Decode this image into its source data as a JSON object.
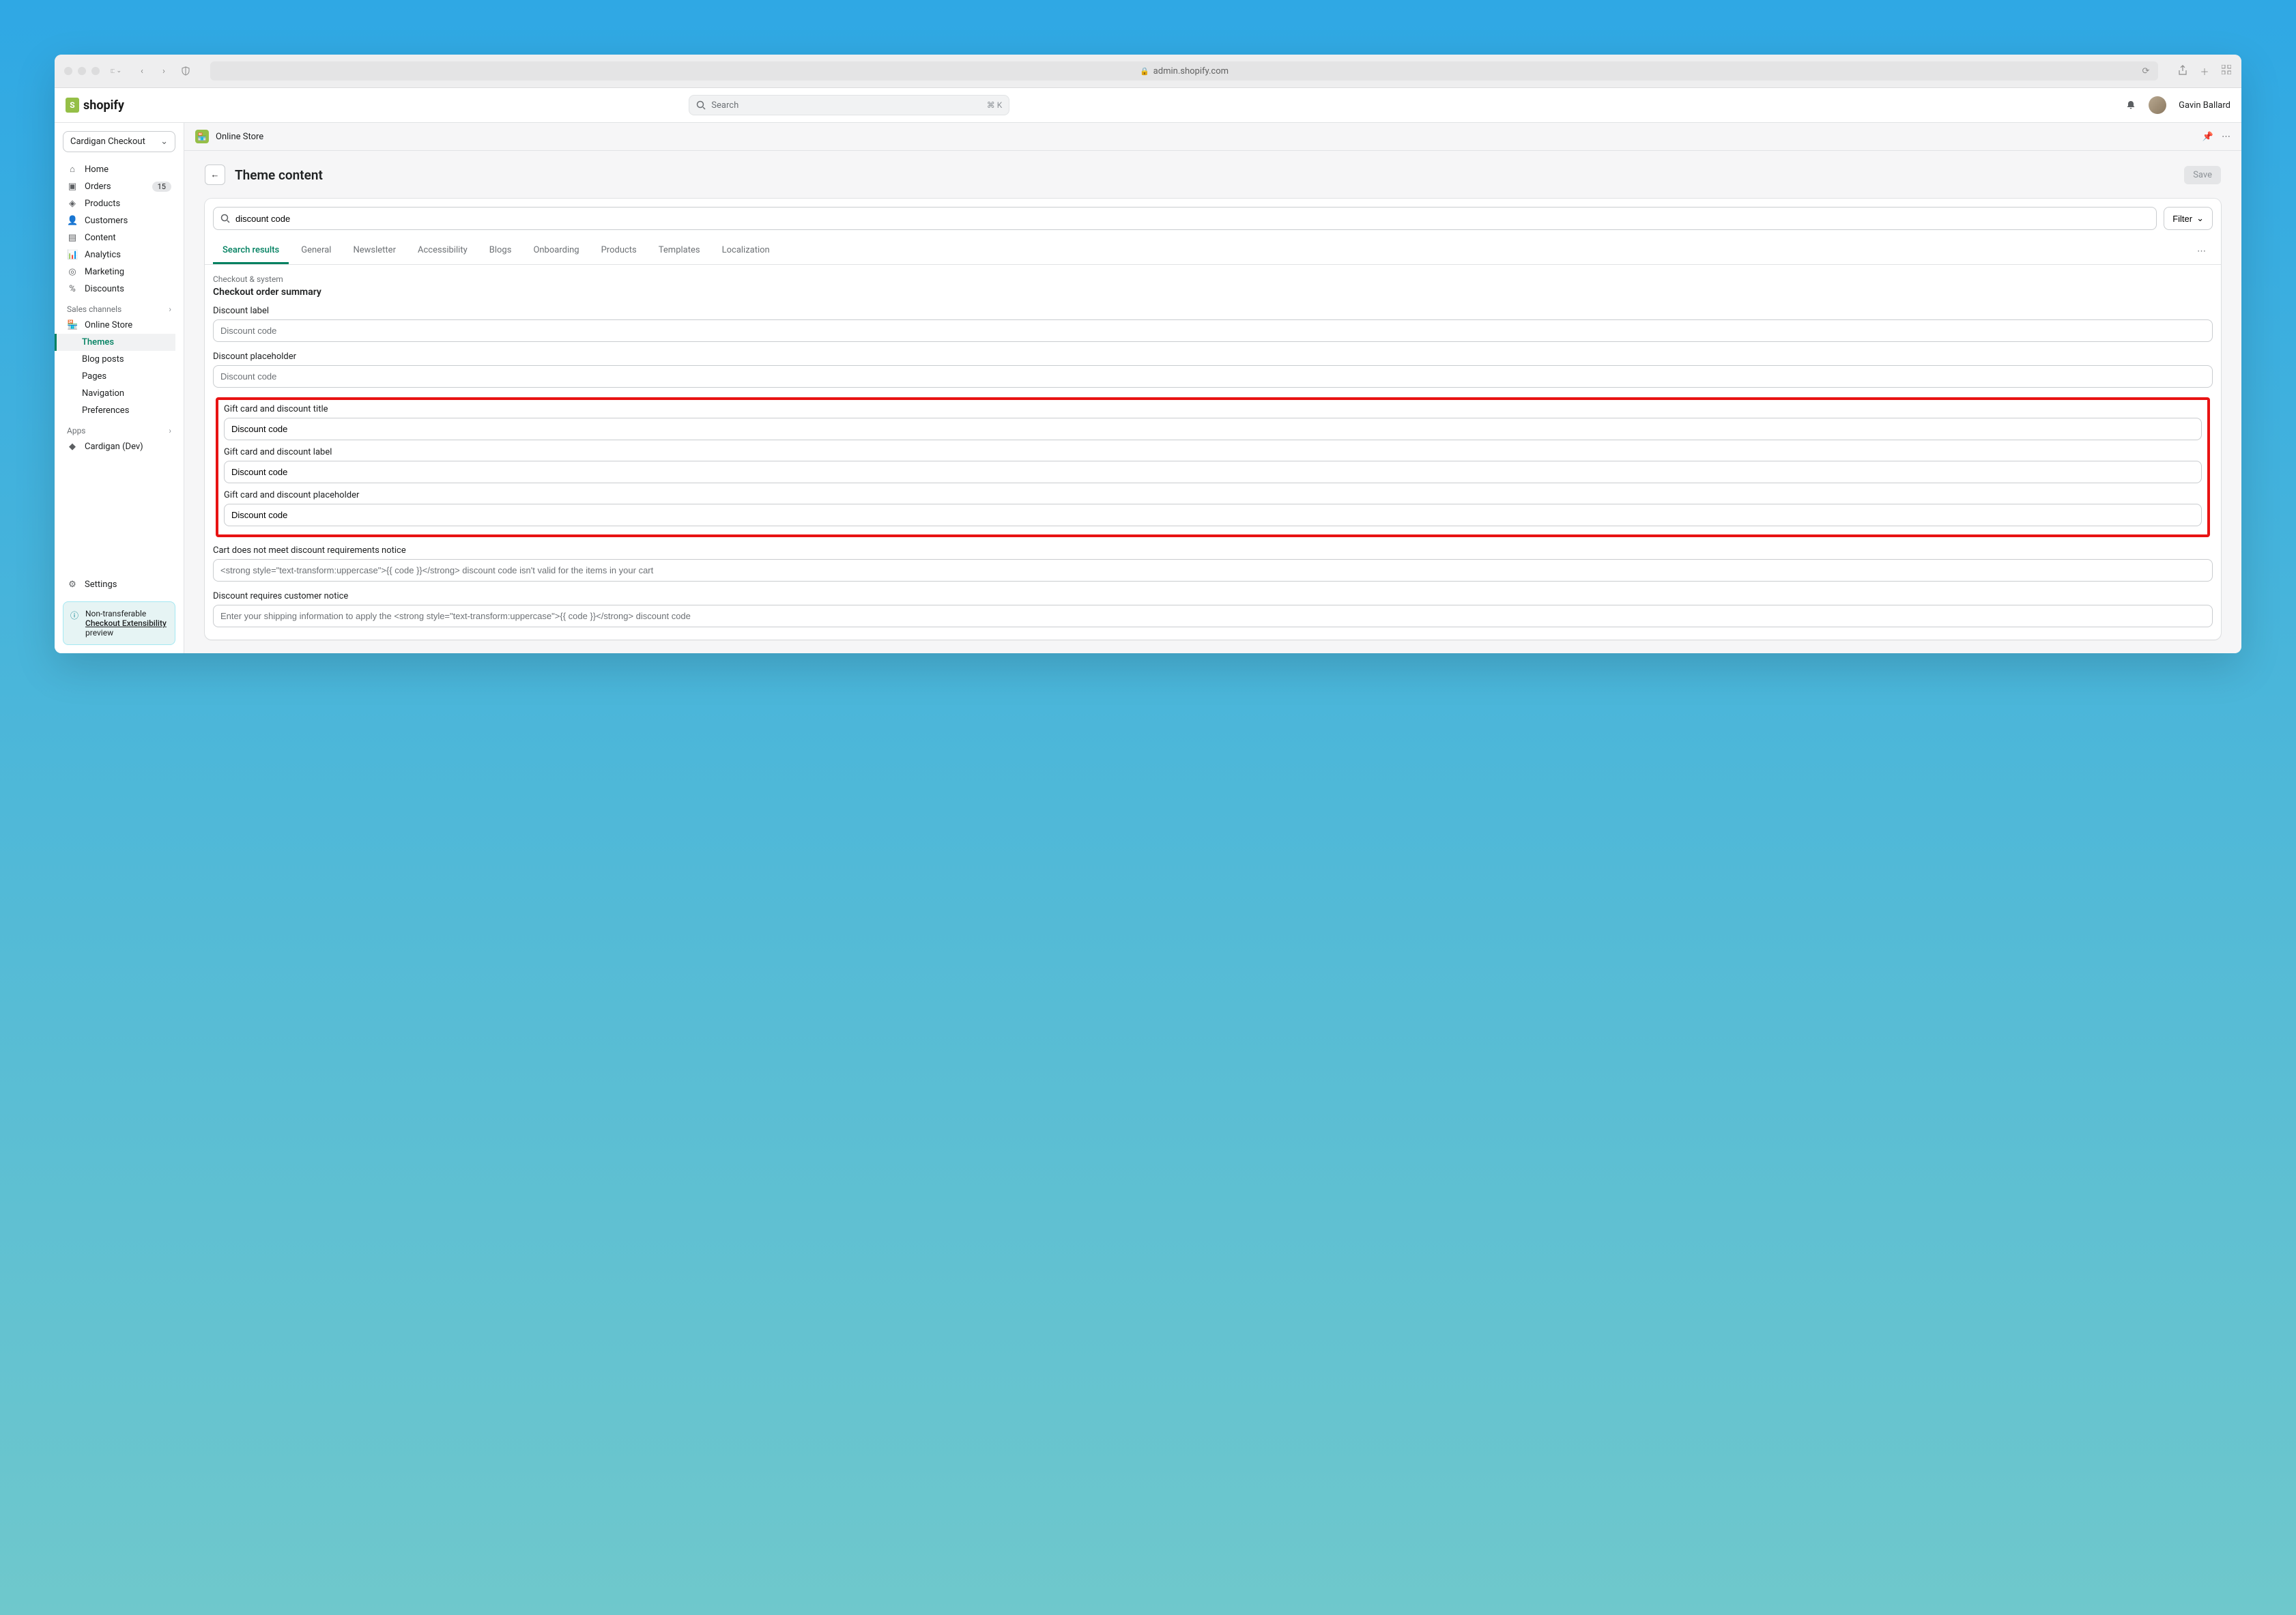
{
  "browser": {
    "url": "admin.shopify.com"
  },
  "header": {
    "brand": "shopify",
    "search_placeholder": "Search",
    "search_shortcut": "⌘ K",
    "user_name": "Gavin Ballard"
  },
  "sidebar": {
    "store_name": "Cardigan Checkout",
    "items": [
      {
        "label": "Home"
      },
      {
        "label": "Orders",
        "badge": "15"
      },
      {
        "label": "Products"
      },
      {
        "label": "Customers"
      },
      {
        "label": "Content"
      },
      {
        "label": "Analytics"
      },
      {
        "label": "Marketing"
      },
      {
        "label": "Discounts"
      }
    ],
    "section_channels": "Sales channels",
    "online_store": "Online Store",
    "online_store_children": [
      "Themes",
      "Blog posts",
      "Pages",
      "Navigation",
      "Preferences"
    ],
    "section_apps": "Apps",
    "app_label": "Cardigan (Dev)",
    "settings": "Settings",
    "banner_title": "Non-transferable",
    "banner_link": "Checkout Extensibility",
    "banner_suffix": "preview"
  },
  "content": {
    "topbar_label": "Online Store",
    "back": "←",
    "page_title": "Theme content",
    "save_label": "Save",
    "search_value": "discount code",
    "filter_label": "Filter",
    "tabs": [
      "Search results",
      "General",
      "Newsletter",
      "Accessibility",
      "Blogs",
      "Onboarding",
      "Products",
      "Templates",
      "Localization"
    ],
    "section_category": "Checkout & system",
    "section_title": "Checkout order summary",
    "fields": [
      {
        "label": "Discount label",
        "value": "",
        "placeholder": "Discount code"
      },
      {
        "label": "Discount placeholder",
        "value": "",
        "placeholder": "Discount code"
      }
    ],
    "highlighted_fields": [
      {
        "label": "Gift card and discount title",
        "value": "Discount code"
      },
      {
        "label": "Gift card and discount label",
        "value": "Discount code"
      },
      {
        "label": "Gift card and discount placeholder",
        "value": "Discount code"
      }
    ],
    "fields_after": [
      {
        "label": "Cart does not meet discount requirements notice",
        "value": "",
        "placeholder": "<strong style=\"text-transform:uppercase\">{{ code }}</strong> discount code isn't valid for the items in your cart"
      },
      {
        "label": "Discount requires customer notice",
        "value": "",
        "placeholder": "Enter your shipping information to apply the <strong style=\"text-transform:uppercase\">{{ code }}</strong> discount code"
      }
    ]
  }
}
